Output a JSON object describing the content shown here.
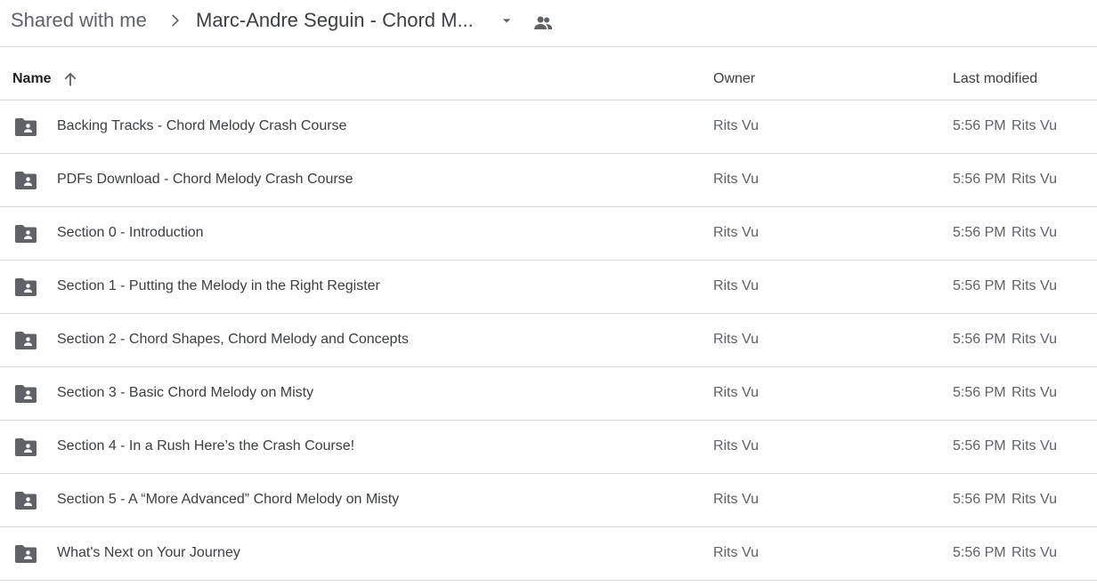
{
  "breadcrumb": {
    "root": "Shared with me",
    "current": "Marc-Andre Seguin - Chord M..."
  },
  "columns": {
    "name": "Name",
    "owner": "Owner",
    "modified": "Last modified"
  },
  "icons": {
    "separator": "chevron-right-icon",
    "dropdown": "arrow-drop-down-icon",
    "shared": "people-icon",
    "sort": "arrow-upward-icon",
    "folder": "shared-folder-icon"
  },
  "colors": {
    "icon": "#5f6368",
    "divider": "#dadce0"
  },
  "rows": [
    {
      "name": "Backing Tracks - Chord Melody Crash Course",
      "owner": "Rits Vu",
      "time": "5:56 PM",
      "modifier": "Rits Vu"
    },
    {
      "name": "PDFs Download - Chord Melody Crash Course",
      "owner": "Rits Vu",
      "time": "5:56 PM",
      "modifier": "Rits Vu"
    },
    {
      "name": "Section 0 - Introduction",
      "owner": "Rits Vu",
      "time": "5:56 PM",
      "modifier": "Rits Vu"
    },
    {
      "name": "Section 1 - Putting the Melody in the Right Register",
      "owner": "Rits Vu",
      "time": "5:56 PM",
      "modifier": "Rits Vu"
    },
    {
      "name": "Section 2 - Chord Shapes, Chord Melody and Concepts",
      "owner": "Rits Vu",
      "time": "5:56 PM",
      "modifier": "Rits Vu"
    },
    {
      "name": "Section 3 - Basic Chord Melody on Misty",
      "owner": "Rits Vu",
      "time": "5:56 PM",
      "modifier": "Rits Vu"
    },
    {
      "name": "Section 4 - In a Rush Here’s the Crash Course!",
      "owner": "Rits Vu",
      "time": "5:56 PM",
      "modifier": "Rits Vu"
    },
    {
      "name": "Section 5 - A “More Advanced” Chord Melody on Misty",
      "owner": "Rits Vu",
      "time": "5:56 PM",
      "modifier": "Rits Vu"
    },
    {
      "name": "What's Next on Your Journey",
      "owner": "Rits Vu",
      "time": "5:56 PM",
      "modifier": "Rits Vu"
    }
  ]
}
